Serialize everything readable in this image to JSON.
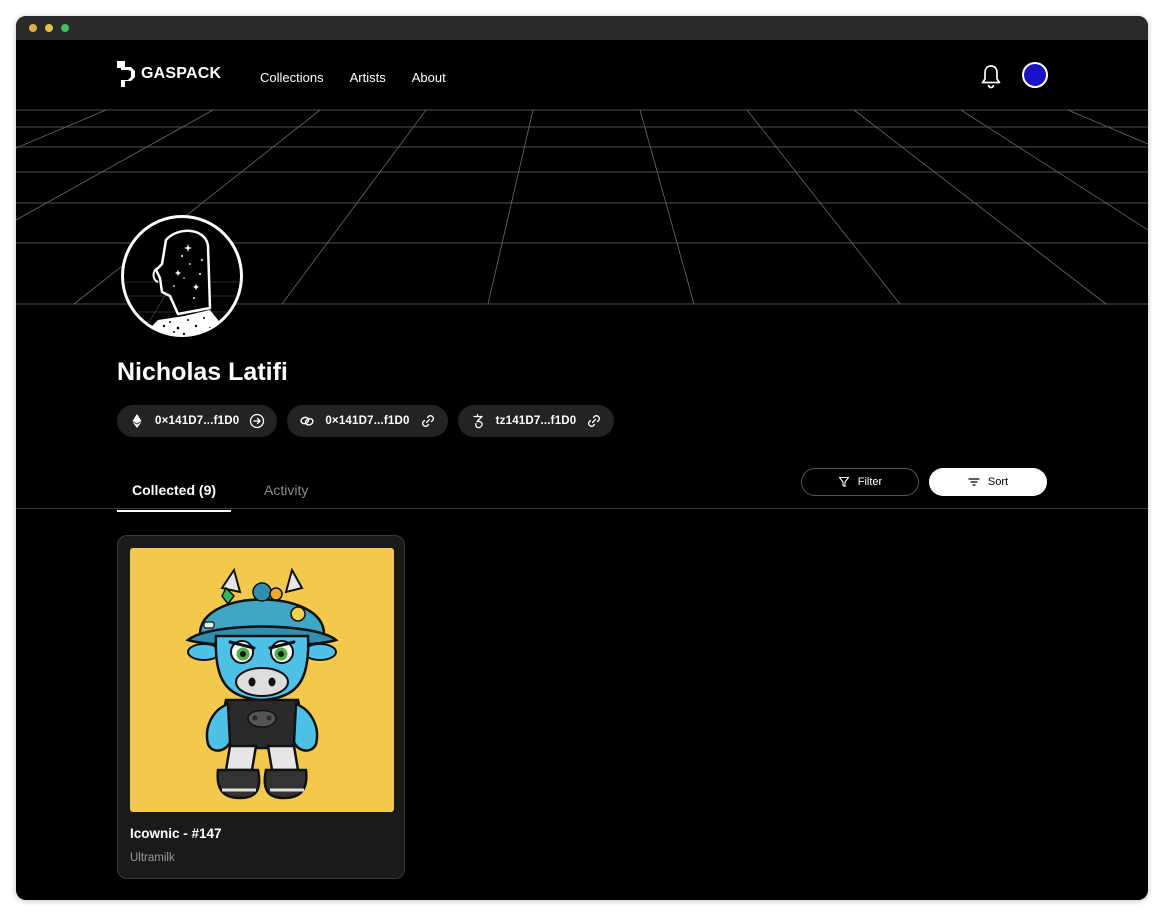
{
  "brand": {
    "name": "GASPACK"
  },
  "nav": {
    "items": [
      "Collections",
      "Artists",
      "About"
    ]
  },
  "profile": {
    "name": "Nicholas Latifi",
    "wallets": [
      {
        "icon": "ethereum-icon",
        "address": "0×141D7...f1D0",
        "action_icon": "arrow-right-circle-icon"
      },
      {
        "icon": "chain-link-icon",
        "address": "0×141D7...f1D0",
        "action_icon": "link-icon"
      },
      {
        "icon": "tezos-icon",
        "address": "tz141D7...f1D0",
        "action_icon": "link-icon"
      }
    ]
  },
  "tabs": [
    {
      "label": "Collected (9)",
      "active": true
    },
    {
      "label": "Activity",
      "active": false
    }
  ],
  "toolbar": {
    "filter_label": "Filter",
    "sort_label": "Sort"
  },
  "cards": [
    {
      "title": "Icownic - #147",
      "collection": "Ultramilk"
    }
  ],
  "colors": {
    "background": "#000000",
    "chip": "#232323",
    "card": "#1a1a1a",
    "card_art": "#f2c94c",
    "avatar": "#1a12c9"
  }
}
